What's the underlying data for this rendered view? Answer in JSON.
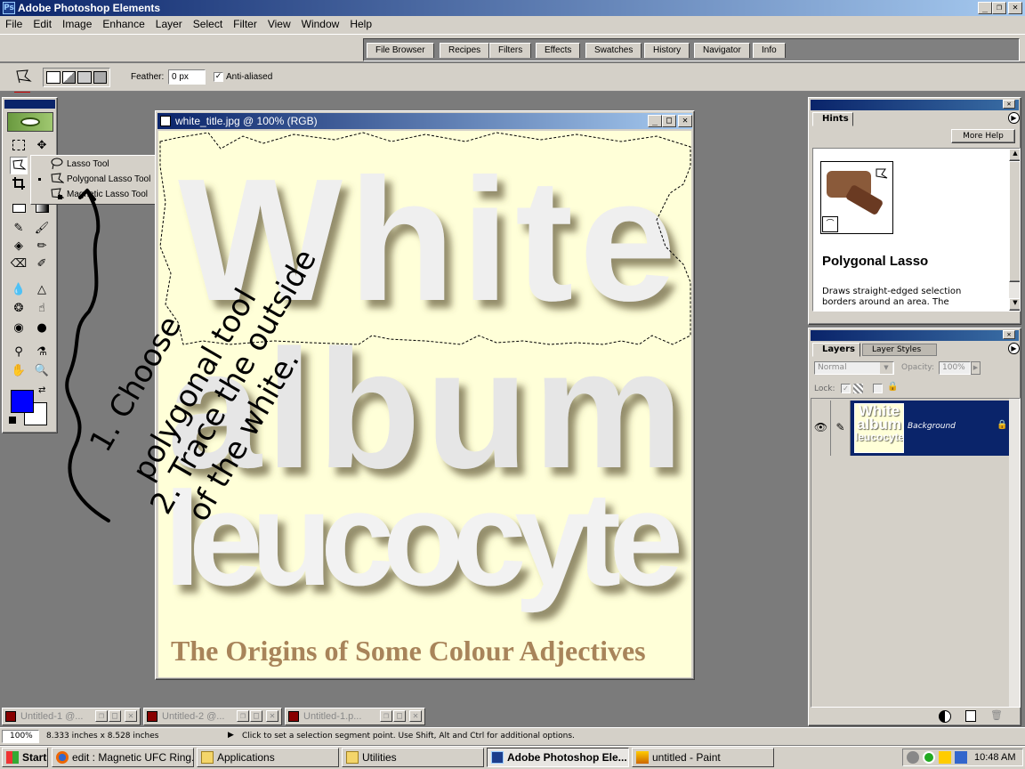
{
  "app": {
    "title": "Adobe Photoshop Elements"
  },
  "menu": [
    "File",
    "Edit",
    "Image",
    "Enhance",
    "Layer",
    "Select",
    "Filter",
    "View",
    "Window",
    "Help"
  ],
  "palette_tabs": [
    "File Browser",
    "Recipes",
    "Filters",
    "Effects",
    "Swatches",
    "History",
    "Navigator",
    "Info"
  ],
  "options": {
    "feather_label": "Feather:",
    "feather_value": "0 px",
    "antialias_label": "Anti-aliased",
    "antialias_checked": true
  },
  "flyout": [
    {
      "label": "Lasso Tool",
      "key": "L",
      "selected": false
    },
    {
      "label": "Polygonal Lasso Tool",
      "key": "L",
      "selected": true
    },
    {
      "label": "Magnetic Lasso Tool",
      "key": "L",
      "selected": false
    }
  ],
  "colors": {
    "foreground": "#0000ff",
    "background": "#ffffff",
    "titlebar": "#0a246a",
    "canvas_bg": "#ffffd8",
    "subtitle": "#a8845a"
  },
  "document": {
    "title": "white_title.jpg @ 100% (RGB)",
    "words": [
      "White",
      "album",
      "leucocyte"
    ],
    "subtitle": "The Origins of Some Colour Adjectives"
  },
  "annotation": {
    "line1": "1. Choose",
    "line2": "polygonal tool",
    "line3": "2. Trace the outside",
    "line4": "of the white."
  },
  "hints": {
    "tab": "Hints",
    "more_help": "More Help",
    "heading": "Polygonal Lasso",
    "body": "Draws straight-edged selection borders around an area. The"
  },
  "layers": {
    "tab": "Layers",
    "tab2": "Layer Styles",
    "mode": "Normal",
    "opacity_label": "Opacity:",
    "opacity": "100%",
    "lock_label": "Lock:",
    "layer_name": "Background",
    "thumb_words": [
      "White",
      "album",
      "leucocyte"
    ]
  },
  "minimized": [
    {
      "label": "Untitled-1 @..."
    },
    {
      "label": "Untitled-2 @..."
    },
    {
      "label": "Untitled-1.p..."
    }
  ],
  "status": {
    "zoom": "100%",
    "size": "8.333 inches x 8.528 inches",
    "message": "Click to set a selection segment point.  Use Shift, Alt and Ctrl for additional options."
  },
  "taskbar": {
    "start": "Start",
    "items": [
      "edit : Magnetic UFC Ring...",
      "Applications",
      "Utilities",
      "Adobe Photoshop Ele...",
      "untitled - Paint"
    ],
    "clock": "10:48 AM"
  }
}
